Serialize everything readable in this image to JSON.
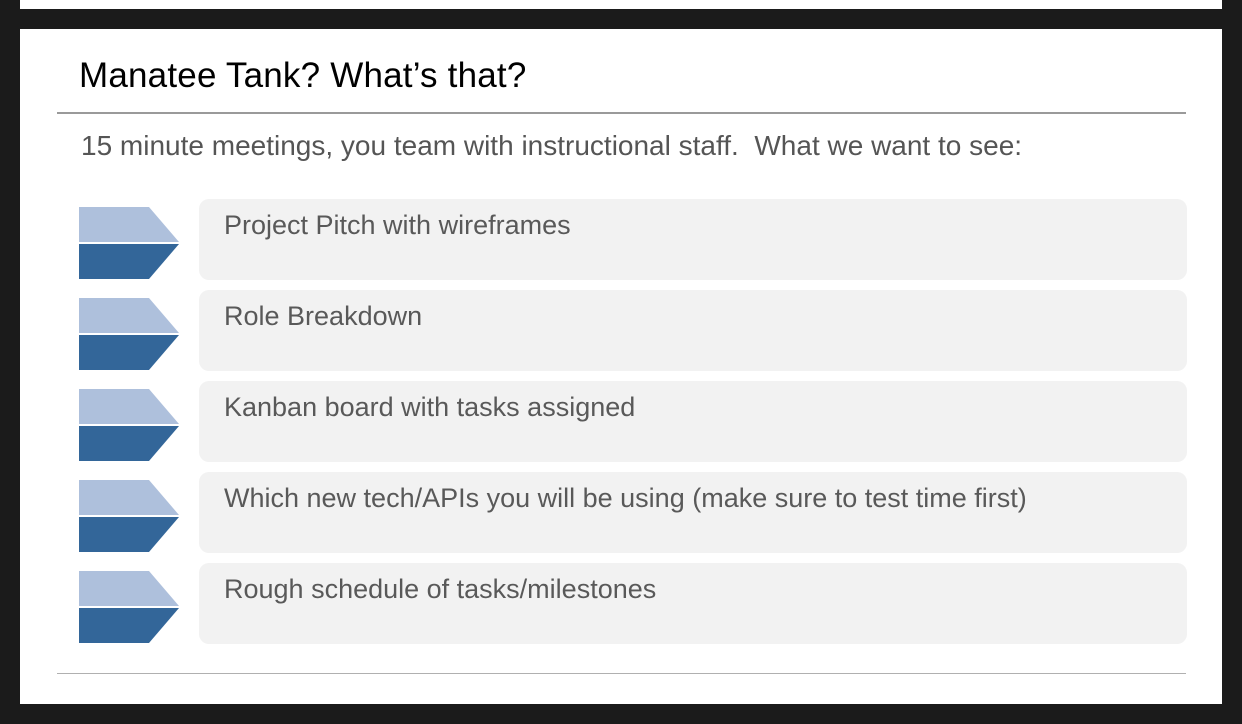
{
  "slide": {
    "title": "Manatee Tank? What’s that?",
    "intro": "15 minute meetings, you team with instructional staff.  What we want to see:",
    "items": [
      {
        "label": "Project Pitch with wireframes",
        "icon": "chevron-bullet-icon"
      },
      {
        "label": "Role Breakdown",
        "icon": "chevron-bullet-icon"
      },
      {
        "label": "Kanban board with tasks assigned",
        "icon": "chevron-bullet-icon"
      },
      {
        "label": "Which new tech/APIs you will be using (make sure to test time first)",
        "icon": "chevron-bullet-icon"
      },
      {
        "label": "Rough schedule of tasks/milestones",
        "icon": "chevron-bullet-icon"
      }
    ]
  },
  "colors": {
    "chevron_top": "#aec0dc",
    "chevron_bottom": "#336699",
    "item_background": "#f2f2f2",
    "page_background": "#1b1b1b"
  }
}
